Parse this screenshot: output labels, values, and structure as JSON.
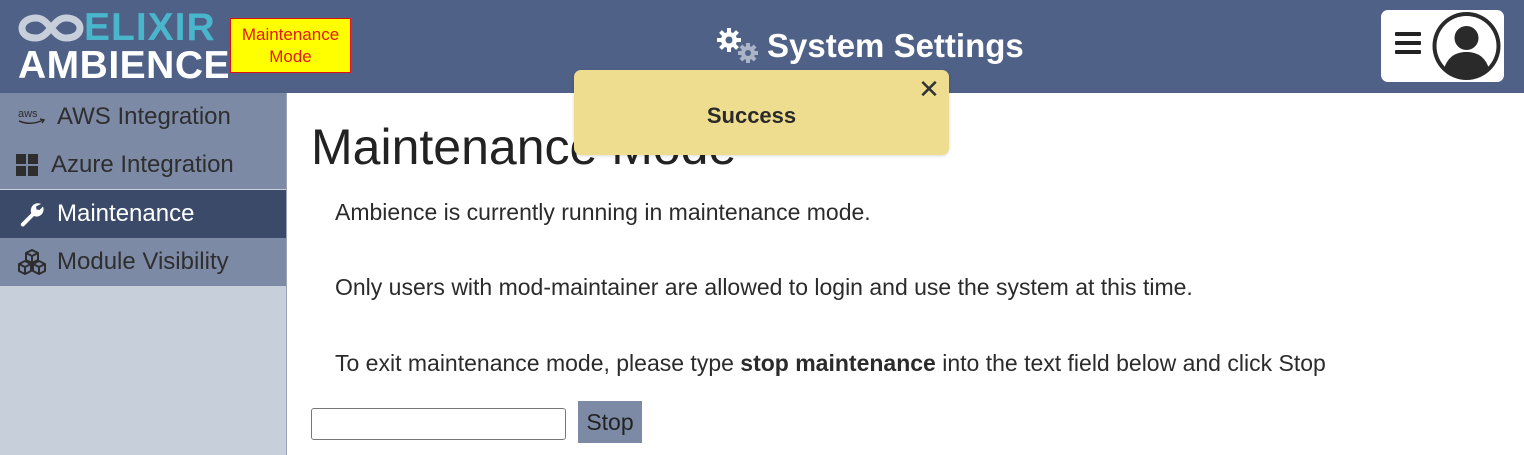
{
  "header": {
    "logo_top": "ELIXIR",
    "logo_bottom": "AMBIENCE",
    "maintenance_badge": "Maintenance Mode",
    "title": "System Settings",
    "title_icon": "gears-icon",
    "menu_icon": "hamburger-menu-icon",
    "avatar_icon": "user-avatar-icon"
  },
  "sidebar": {
    "items": [
      {
        "label": "AWS Integration",
        "icon": "aws-icon"
      },
      {
        "label": "Azure Integration",
        "icon": "windows-icon"
      },
      {
        "label": "Maintenance",
        "icon": "wrench-icon",
        "active": true
      },
      {
        "label": "Module Visibility",
        "icon": "cubes-icon"
      }
    ]
  },
  "main": {
    "title": "Maintenance Mode",
    "line1": "Ambience is currently running in maintenance mode.",
    "line2": "Only users with mod-maintainer are allowed to login and use the system at this time.",
    "line3_pre": "To exit maintenance mode, please type ",
    "line3_bold": "stop maintenance",
    "line3_post": " into the text field below and click Stop",
    "input_value": "",
    "stop_label": "Stop"
  },
  "toast": {
    "message": "Success",
    "close_label": "✕"
  },
  "colors": {
    "header_bg": "#4f6187",
    "accent": "#49b6cc",
    "sidebar_item": "#7d8aa6",
    "sidebar_active": "#3b4a68",
    "sidebar_bg": "#c7cfdb",
    "toast_bg": "#eedd8e",
    "badge_bg": "#ffff00",
    "badge_text": "#e01818"
  }
}
